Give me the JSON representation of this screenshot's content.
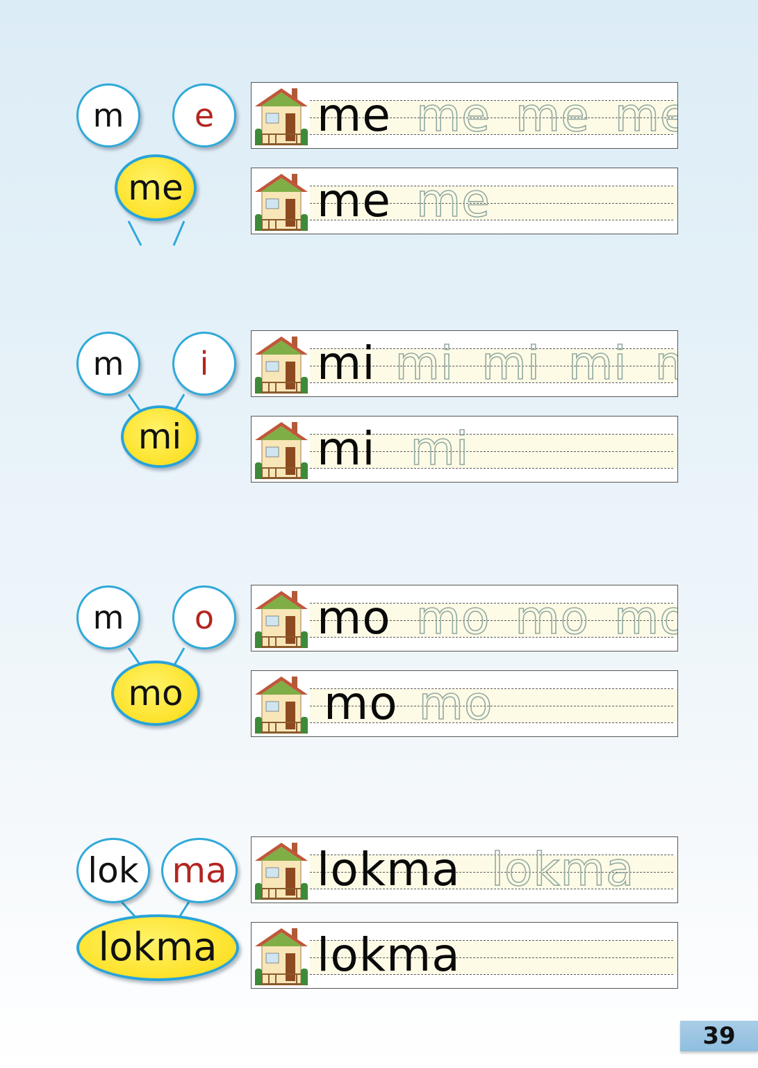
{
  "groups": [
    {
      "left": "m",
      "right": "e",
      "syllable": "me",
      "line1": {
        "model": "me",
        "trace": [
          "me",
          "me",
          "me"
        ]
      },
      "line2": {
        "model": "me",
        "trace": [
          "me"
        ]
      }
    },
    {
      "left": "m",
      "right": "i",
      "syllable": "mi",
      "line1": {
        "model": "mi",
        "trace": [
          "mi",
          "mi",
          "mi",
          "mi"
        ]
      },
      "line2": {
        "model": "mi",
        "trace": [
          "mi"
        ]
      }
    },
    {
      "left": "m",
      "right": "o",
      "syllable": "mo",
      "line1": {
        "model": "mo",
        "trace": [
          "mo",
          "mo",
          "mo"
        ]
      },
      "line2": {
        "model": "mo",
        "trace": [
          "mo"
        ]
      }
    },
    {
      "left": "lok",
      "right": "ma",
      "syllable": "lokma",
      "line1": {
        "model": "lokma",
        "trace": [
          "lokma"
        ]
      },
      "line2": {
        "model": "lokma",
        "trace": []
      }
    }
  ],
  "page_number": "39",
  "colors": {
    "bubble_border": "#2fa9d9",
    "syllable_fill": "#fde22a",
    "vowel_text": "#b32620",
    "trace_text": "#93a9a2",
    "page_tab": "#9fc8e3"
  },
  "icons": {
    "line_start": "house-icon"
  }
}
